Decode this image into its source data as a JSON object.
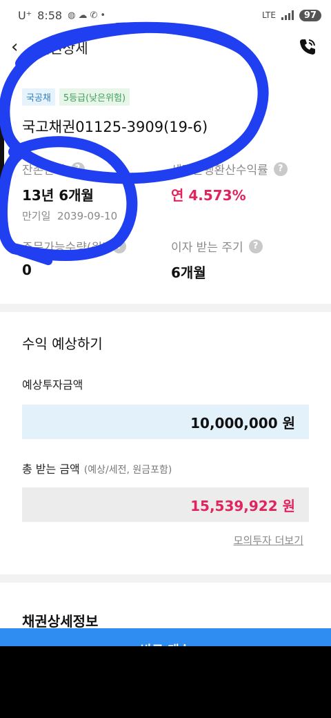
{
  "status_bar": {
    "carrier": "U⁺",
    "time": "8:58",
    "network": "LTE",
    "battery": "97"
  },
  "header": {
    "title": "채권상세"
  },
  "summary": {
    "tags": [
      "국공채",
      "5등급(낮은위험)"
    ],
    "bond_name": "국고채권01125-3909(19-6)",
    "remaining_label": "잔존만기",
    "remaining_value": "13년 6개월",
    "maturity_label": "만기일",
    "maturity_date": "2039-09-10",
    "yield_label": "세전은행환산수익률",
    "yield_value": "연 4.573%",
    "min_amount_label": "주문가능수량(원)",
    "min_amount_value": "0",
    "interest_label": "이자 받는 주기",
    "interest_value": "6개월"
  },
  "estimate": {
    "title": "수익 예상하기",
    "invest_label": "예상투자금액",
    "invest_amount": "10,000,000 원",
    "total_label": "총 받는 금액",
    "total_note": "(예상/세전, 원금포함)",
    "total_amount": "15,539,922 원",
    "more_link": "모의투자 더보기"
  },
  "detail": {
    "title": "채권상세정보",
    "cta_label": "바로 매수"
  },
  "colors": {
    "accent_red": "#e0245e",
    "scribble_blue": "#1f3ff0",
    "cta_blue": "#2f8cf0"
  }
}
